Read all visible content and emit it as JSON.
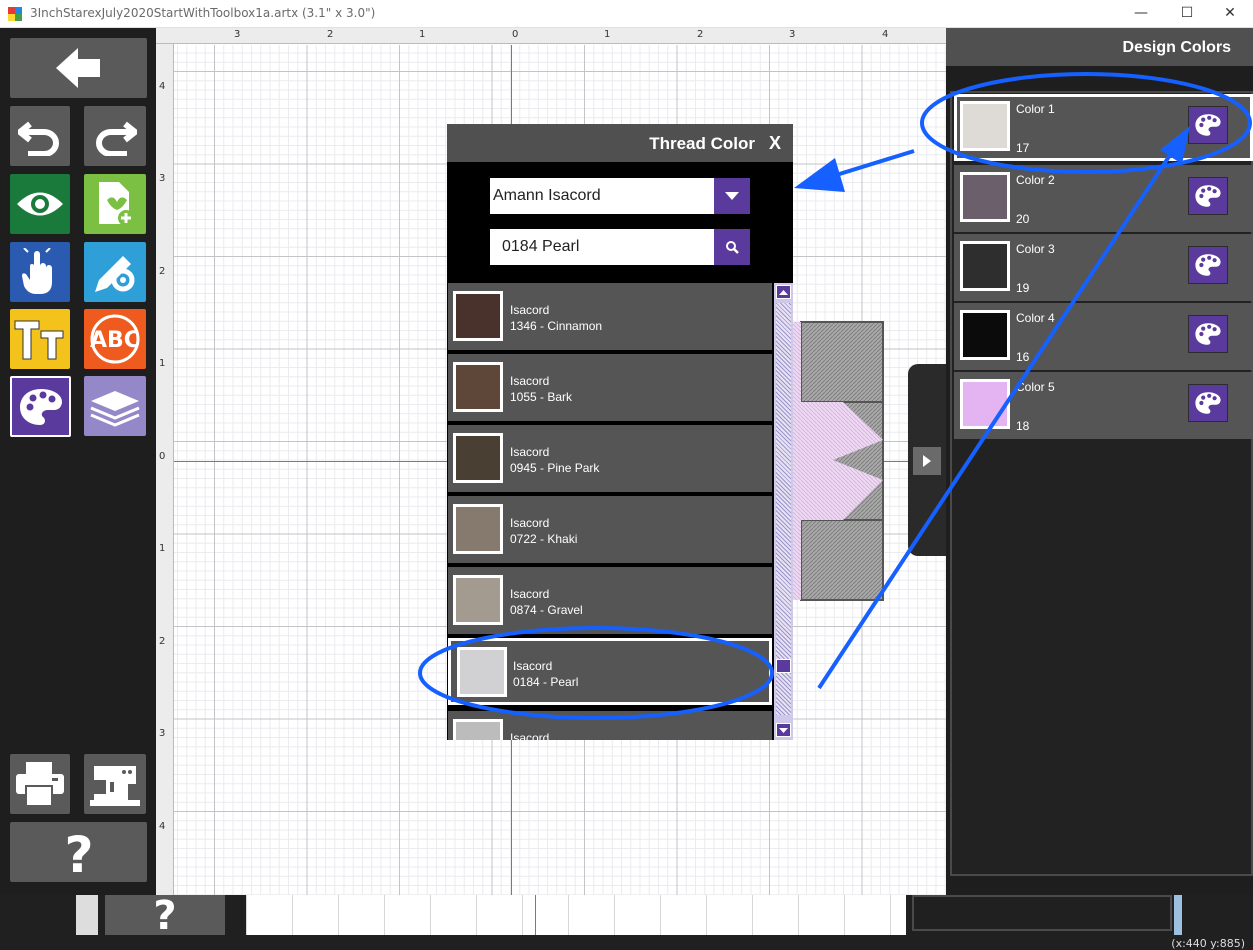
{
  "window": {
    "title": "3InchStarexJuly2020StartWithToolbox1a.artx (3.1\" x 3.0\")",
    "minimize": "—",
    "maximize": "☐",
    "close": "✕"
  },
  "rulers": {
    "top": [
      "3",
      "2",
      "1",
      "0",
      "1",
      "2",
      "3",
      "4"
    ],
    "left": [
      "4",
      "3",
      "2",
      "1",
      "0",
      "1",
      "2",
      "3",
      "4"
    ]
  },
  "thread_dialog": {
    "title": "Thread Color",
    "close_label": "X",
    "brand_value": "Amann Isacord",
    "search_value": "0184 Pearl",
    "threads": [
      {
        "brand": "Isacord",
        "name": "1346 - Cinnamon",
        "color": "#4a322c"
      },
      {
        "brand": "Isacord",
        "name": "1055 - Bark",
        "color": "#5e4638"
      },
      {
        "brand": "Isacord",
        "name": "0945 - Pine Park",
        "color": "#4a3f33"
      },
      {
        "brand": "Isacord",
        "name": "0722 - Khaki",
        "color": "#857a6d"
      },
      {
        "brand": "Isacord",
        "name": "0874 - Gravel",
        "color": "#a39a90"
      },
      {
        "brand": "Isacord",
        "name": "0184 - Pearl",
        "color": "#d1d1d3",
        "selected": true
      },
      {
        "brand": "Isacord",
        "name": "",
        "color": "#bcbcbc"
      }
    ]
  },
  "design_colors": {
    "title": "Design Colors",
    "colors": [
      {
        "label": "Color 1",
        "number": "17",
        "color": "#dedbd6",
        "selected": true
      },
      {
        "label": "Color 2",
        "number": "20",
        "color": "#6a5f6b"
      },
      {
        "label": "Color 3",
        "number": "19",
        "color": "#2e2e2e"
      },
      {
        "label": "Color 4",
        "number": "16",
        "color": "#0b0b0b"
      },
      {
        "label": "Color 5",
        "number": "18",
        "color": "#e4b3f2"
      }
    ]
  },
  "status": "(x:440 y:885)",
  "colors": {
    "accent_purple": "#5a3a9c",
    "annotation_blue": "#1560ff",
    "toolbar_green": "#1a7a3c",
    "toolbar_blue": "#2a5bb0",
    "toolbar_yellow": "#f3c31c",
    "toolbar_orange": "#ef5a1e"
  }
}
